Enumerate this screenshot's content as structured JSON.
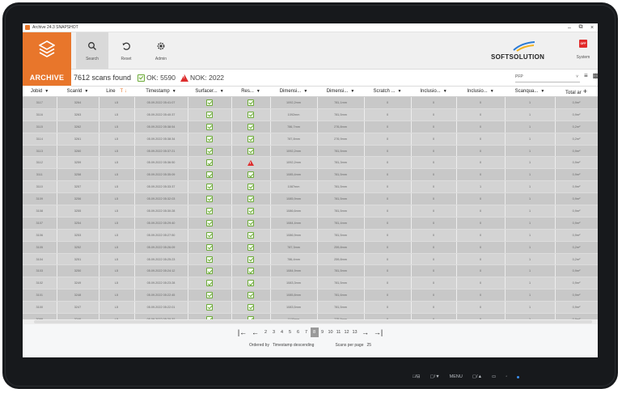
{
  "window": {
    "title": "Archive 24.3 SNAPSHOT",
    "minimize": "–",
    "restore": "⧉",
    "close": "×"
  },
  "toolbar": {
    "logo_label": "ARCHIVE",
    "search_label": "Search",
    "reset_label": "Reset",
    "admin_label": "Admin",
    "brand": "SOFTSOLUTION",
    "system_label": "System",
    "system_badge": "OFF"
  },
  "status": {
    "scans_found": "7612 scans found",
    "ok": "OK: 5590",
    "nok": "NOK: 2022",
    "filter_value": "PFP",
    "filter_caret": "˅"
  },
  "table": {
    "columns": [
      "Jobid",
      "ScanId",
      "Line",
      "Timestamp",
      "Surfacer...",
      "Res...",
      "Dimensi...",
      "Dimensi...",
      "Scratch ...",
      "Inclusio...",
      "Inclusio...",
      "Scanqua...",
      "Total ar"
    ],
    "rows": [
      [
        "3117",
        "3264",
        "L5",
        "05.09.2022 05:41:07",
        "ok",
        "ok",
        "1092,2mm",
        "781,1mm",
        "0",
        "0",
        "0",
        "1",
        "0,9m²"
      ],
      [
        "3116",
        "3263",
        "L5",
        "05.09.2022 05:40:37",
        "ok",
        "ok",
        "1092mm",
        "781,5mm",
        "0",
        "0",
        "0",
        "1",
        "0,9m²"
      ],
      [
        "3115",
        "3262",
        "L5",
        "05.09.2022 05:38:54",
        "ok",
        "ok",
        "786,7mm",
        "276,8mm",
        "0",
        "0",
        "0",
        "1",
        "0,2m²"
      ],
      [
        "3114",
        "3261",
        "L5",
        "05.09.2022 05:38:34",
        "ok",
        "ok",
        "787,8mm",
        "276,9mm",
        "0",
        "0",
        "0",
        "1",
        "0,2m²"
      ],
      [
        "3113",
        "3260",
        "L5",
        "05.09.2022 05:37:21",
        "ok",
        "ok",
        "1092,2mm",
        "781,5mm",
        "0",
        "0",
        "0",
        "1",
        "0,9m²"
      ],
      [
        "3112",
        "3259",
        "L5",
        "05.09.2022 05:36:50",
        "ok",
        "nok",
        "1092,2mm",
        "781,3mm",
        "0",
        "0",
        "0",
        "1",
        "0,9m²"
      ],
      [
        "3111",
        "3258",
        "L5",
        "05.09.2022 05:35:09",
        "ok",
        "ok",
        "1085,4mm",
        "781,5mm",
        "0",
        "0",
        "0",
        "1",
        "0,9m²"
      ],
      [
        "3110",
        "3257",
        "L5",
        "05.09.2022 05:33:37",
        "ok",
        "ok",
        "1087mm",
        "781,5mm",
        "0",
        "0",
        "1",
        "1",
        "0,9m²"
      ],
      [
        "3109",
        "3256",
        "L5",
        "05.09.2022 05:32:03",
        "ok",
        "ok",
        "1085,9mm",
        "781,5mm",
        "0",
        "0",
        "0",
        "1",
        "0,9m²"
      ],
      [
        "3108",
        "3255",
        "L5",
        "05.09.2022 05:30:28",
        "ok",
        "ok",
        "1086,6mm",
        "781,5mm",
        "0",
        "0",
        "0",
        "1",
        "0,9m²"
      ],
      [
        "3107",
        "3254",
        "L5",
        "05.09.2022 05:29:40",
        "ok",
        "ok",
        "1084,4mm",
        "781,4mm",
        "0",
        "0",
        "0",
        "1",
        "0,9m²"
      ],
      [
        "3106",
        "3253",
        "L5",
        "05.09.2022 05:27:50",
        "ok",
        "ok",
        "1086,9mm",
        "781,5mm",
        "0",
        "0",
        "0",
        "1",
        "0,9m²"
      ],
      [
        "3105",
        "3252",
        "L5",
        "05.09.2022 05:26:09",
        "ok",
        "ok",
        "787,3mm",
        "259,8mm",
        "0",
        "0",
        "0",
        "1",
        "0,2m²"
      ],
      [
        "3104",
        "3251",
        "L5",
        "05.09.2022 05:25:23",
        "ok",
        "ok",
        "786,4mm",
        "259,8mm",
        "0",
        "0",
        "0",
        "1",
        "0,2m²"
      ],
      [
        "3103",
        "3250",
        "L5",
        "05.09.2022 05:24:12",
        "ok",
        "ok",
        "1084,9mm",
        "781,5mm",
        "0",
        "0",
        "0",
        "1",
        "0,9m²"
      ],
      [
        "3102",
        "3249",
        "L5",
        "05.09.2022 05:23:28",
        "ok",
        "ok",
        "1083,3mm",
        "781,5mm",
        "0",
        "0",
        "0",
        "1",
        "0,9m²"
      ],
      [
        "3101",
        "3248",
        "L5",
        "05.09.2022 05:22:45",
        "ok",
        "ok",
        "1085,8mm",
        "781,6mm",
        "0",
        "0",
        "0",
        "1",
        "0,9m²"
      ],
      [
        "3100",
        "3247",
        "L5",
        "05.09.2022 05:22:01",
        "ok",
        "ok",
        "1083,5mm",
        "781,5mm",
        "0",
        "0",
        "0",
        "1",
        "0,9m²"
      ],
      [
        "3099",
        "3246",
        "L5",
        "05.09.2022 05:20:32",
        "ok",
        "ok",
        "1100mm",
        "775,5mm",
        "0",
        "0",
        "0",
        "1",
        "0,9m²"
      ]
    ]
  },
  "pager": {
    "first": "|←",
    "prev": "←",
    "next": "→",
    "last": "→|",
    "pages": [
      "2",
      "3",
      "4",
      "5",
      "6",
      "7",
      "8",
      "9",
      "10",
      "11",
      "12",
      "13"
    ],
    "active_page": "8"
  },
  "footer": {
    "ordered_by_label": "Ordered by",
    "ordered_by_value": "Timestamp descending",
    "per_page_label": "Scans per page",
    "per_page_value": "25"
  },
  "hardware": {
    "b1": "□/⊟",
    "b2": "▢/▼",
    "b3": "MENU",
    "b4": "▢/▲",
    "b5": "▭",
    "b6": "◦"
  },
  "colors": {
    "accent": "#e8762b",
    "ok": "#6dab3a",
    "nok": "#dd2d2d"
  }
}
